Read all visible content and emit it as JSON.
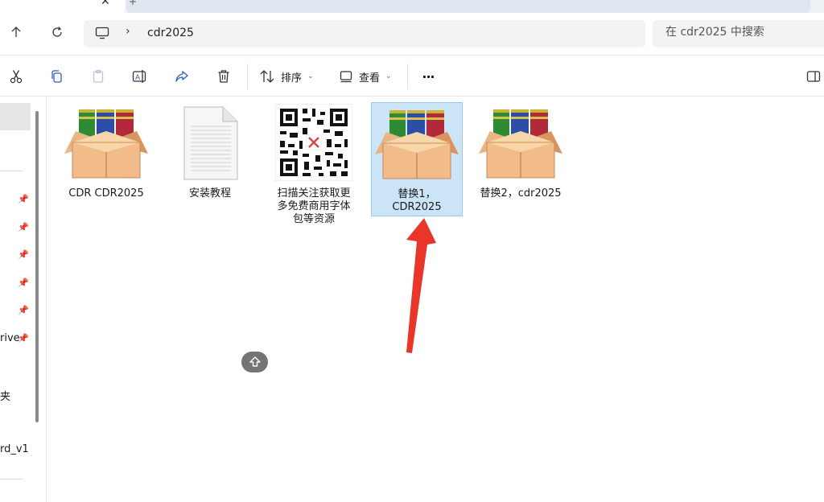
{
  "address": {
    "path": "cdr2025"
  },
  "search": {
    "placeholder": "在 cdr2025 中搜索"
  },
  "toolbar": {
    "sort_label": "排序",
    "view_label": "查看",
    "more_label": "···"
  },
  "sidebar": {
    "items": [
      {
        "label": "rive"
      },
      {
        "label": "夹"
      },
      {
        "label": "rd_v1"
      }
    ]
  },
  "files": [
    {
      "name": "CDR CDR2025",
      "icon": "archive-box-icon"
    },
    {
      "name": "安装教程",
      "icon": "text-document-icon"
    },
    {
      "name": "扫描关注获取更\n多免费商用字体\n包等资源",
      "icon": "qr-code-icon"
    },
    {
      "name": "替换1，\nCDR2025",
      "icon": "archive-box-icon",
      "selected": true
    },
    {
      "name": "替换2，cdr2025",
      "icon": "archive-box-icon"
    }
  ],
  "colors": {
    "selection": "#cce4f7",
    "annotation_arrow": "#e8372a"
  }
}
